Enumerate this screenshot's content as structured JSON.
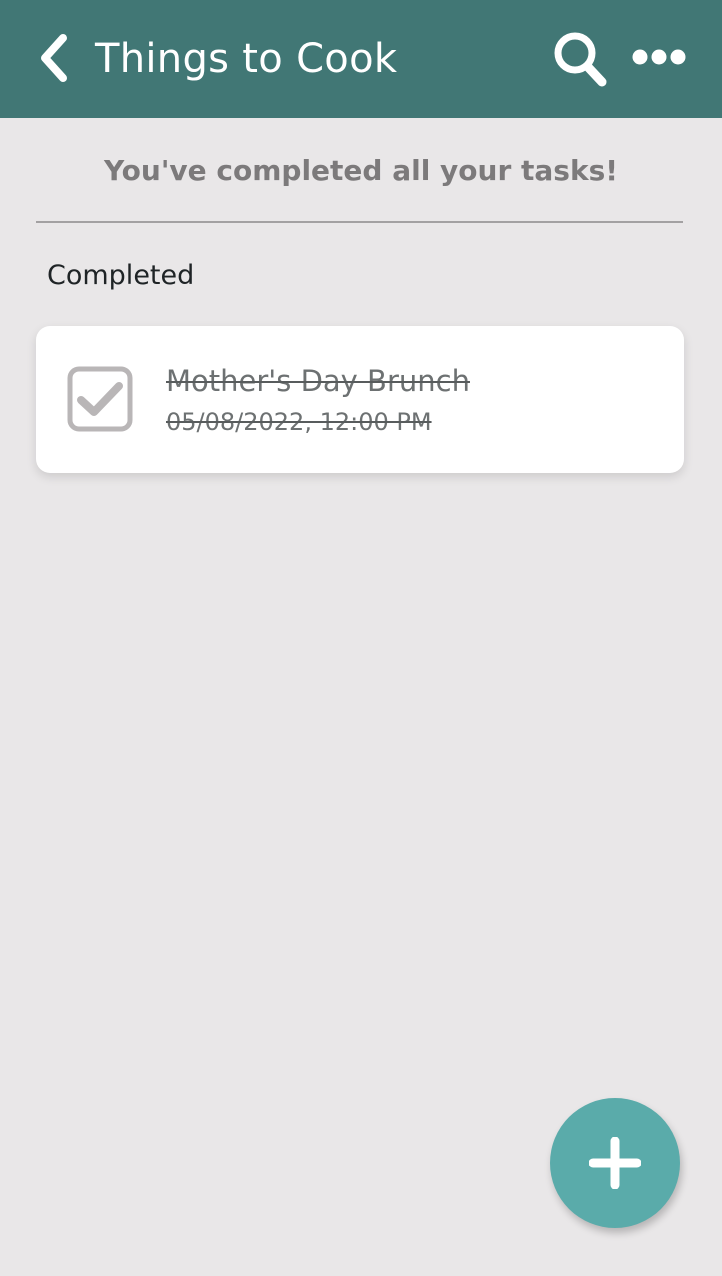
{
  "header": {
    "title": "Things to Cook",
    "back_icon": "chevron-left-icon",
    "search_icon": "search-icon",
    "more_icon": "more-horizontal-icon",
    "background_color": "#417775"
  },
  "empty_state": {
    "message": "You've completed all your tasks!"
  },
  "completed_section": {
    "label": "Completed",
    "tasks": [
      {
        "title": "Mother's Day Brunch",
        "datetime": "05/08/2022, 12:00 PM",
        "completed": true
      }
    ]
  },
  "fab": {
    "icon": "plus-icon",
    "color": "#5aabaa"
  }
}
